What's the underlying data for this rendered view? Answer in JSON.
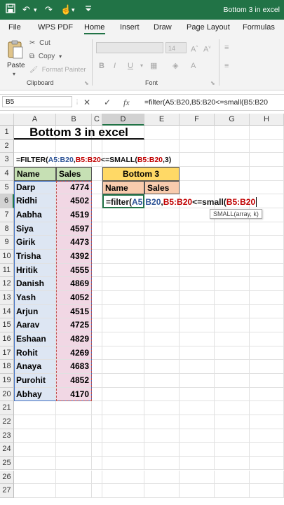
{
  "window": {
    "title": "Bottom 3 in excel"
  },
  "quick_access": {
    "save_icon": "save-icon",
    "undo_icon": "undo-icon",
    "redo_icon": "redo-icon",
    "touch_icon": "touch-mode-icon"
  },
  "tabs": [
    "File",
    "WPS PDF",
    "Home",
    "Insert",
    "Draw",
    "Page Layout",
    "Formulas"
  ],
  "active_tab": "Home",
  "ribbon": {
    "paste_label": "Paste",
    "cut_label": "Cut",
    "copy_label": "Copy",
    "format_painter_label": "Format Painter",
    "clipboard_group": "Clipboard",
    "font_group": "Font",
    "font_size": "14",
    "bold": "B",
    "italic": "I",
    "underline": "U",
    "font_color": "A"
  },
  "formula_bar": {
    "name_box": "B5",
    "cancel_symbol": "✕",
    "enter_symbol": "✓",
    "fx_symbol": "fx",
    "content": "=filter(A5:B20,B5:B20<=small(B5:B20"
  },
  "columns": [
    "A",
    "B",
    "C",
    "D",
    "E",
    "F",
    "G",
    "H"
  ],
  "rows": [
    "1",
    "2",
    "3",
    "4",
    "5",
    "6",
    "7",
    "8",
    "9",
    "10",
    "11",
    "12",
    "13",
    "14",
    "15",
    "16",
    "17",
    "18",
    "19",
    "20",
    "21",
    "22",
    "23",
    "24",
    "25",
    "26",
    "27"
  ],
  "sheet": {
    "title": "Bottom 3 in excel",
    "formula_display": [
      "=FILTER(",
      "A5:B20",
      ",",
      "B5:B20",
      "<=SMALL(",
      "B5:B20",
      ",3)"
    ],
    "header_name": "Name",
    "header_sales": "Sales",
    "data": [
      {
        "name": "Darp",
        "sales": "4774"
      },
      {
        "name": "Ridhi",
        "sales": "4502"
      },
      {
        "name": "Aabha",
        "sales": "4519"
      },
      {
        "name": "Siya",
        "sales": "4597"
      },
      {
        "name": "Girik",
        "sales": "4473"
      },
      {
        "name": "Trisha",
        "sales": "4392"
      },
      {
        "name": "Hritik",
        "sales": "4555"
      },
      {
        "name": "Danish",
        "sales": "4869"
      },
      {
        "name": "Yash",
        "sales": "4052"
      },
      {
        "name": "Arjun",
        "sales": "4515"
      },
      {
        "name": "Aarav",
        "sales": "4725"
      },
      {
        "name": "Eshaan",
        "sales": "4829"
      },
      {
        "name": "Rohit",
        "sales": "4269"
      },
      {
        "name": "Anaya",
        "sales": "4683"
      },
      {
        "name": "Purohit",
        "sales": "4852"
      },
      {
        "name": "Abhay",
        "sales": "4170"
      }
    ],
    "bottom3_title": "Bottom 3",
    "bottom3_name_header": "Name",
    "bottom3_sales_header": "Sales",
    "editing_formula": [
      "=filter(",
      "A5:B20",
      ",",
      "B5:B20",
      "<=small(",
      "B5:B20"
    ],
    "tooltip": "SMALL(array, k)"
  },
  "colors": {
    "excel_green": "#217346",
    "name_fill": "#dde6f3",
    "sales_fill": "#f1d7e4",
    "header_fill": "#c6e0b4",
    "bottom3_title_fill": "#ffd966",
    "bottom3_header_fill": "#f8cbad",
    "ref_blue": "#2f5597",
    "ref_red": "#c00000"
  }
}
